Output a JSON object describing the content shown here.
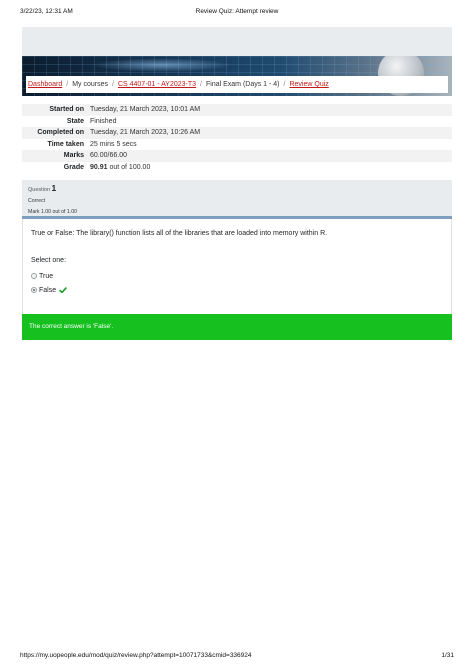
{
  "print": {
    "datetime": "3/22/23, 12:31 AM",
    "page_title": "Review Quiz: Attempt review",
    "url": "https://my.uopeople.edu/mod/quiz/review.php?attempt=10071733&cmid=336924",
    "page_number": "1/31"
  },
  "breadcrumb": {
    "dashboard": "Dashboard",
    "my_courses": "My courses",
    "course": "CS 4407-01 - AY2023-T3",
    "section": "Final Exam (Days 1 - 4)",
    "quiz": "Review Quiz",
    "separator": "/"
  },
  "summary": {
    "started_label": "Started on",
    "started_value": "Tuesday, 21 March 2023, 10:01 AM",
    "state_label": "State",
    "state_value": "Finished",
    "completed_label": "Completed on",
    "completed_value": "Tuesday, 21 March 2023, 10:26 AM",
    "time_label": "Time taken",
    "time_value": "25 mins 5 secs",
    "marks_label": "Marks",
    "marks_value": "60.00/66.00",
    "grade_label": "Grade",
    "grade_score": "90.91",
    "grade_suffix": " out of 100.00"
  },
  "question": {
    "prefix": "Question ",
    "number": "1",
    "status": "Correct",
    "mark": "Mark 1.00 out of 1.00",
    "text": "True or False: The library() function lists all of the libraries that are loaded into memory within R.",
    "select_label": "Select one:",
    "options": [
      {
        "label": "True",
        "selected": false
      },
      {
        "label": "False",
        "selected": true
      }
    ],
    "feedback": "The correct answer is 'False'.",
    "correct_color": "#16c01f"
  }
}
